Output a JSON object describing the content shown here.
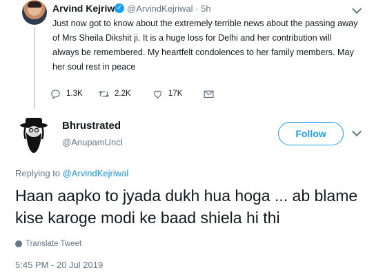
{
  "parent_tweet": {
    "author_name": "Arvind Kejriwal",
    "verified_icon": "✓",
    "handle_time": "@ArvindKejriwal · 5h",
    "text": "Just now got to know about the extremely terrible news about the passing away of Mrs Sheila Dikshit ji. It is a huge loss for Delhi and her contribution will always be remembered. My heartfelt condolences to her family members. May her soul rest in peace",
    "replies": "1.3K",
    "retweets": "2.2K",
    "likes": "17K"
  },
  "reply_tweet": {
    "author_name": "Bhrustrated",
    "handle": "@AnupamUncl",
    "follow_label": "Follow",
    "replying_prefix": "Replying to ",
    "replying_handle": "@ArvindKejriwal",
    "text": "Haan aapko to jyada dukh hua hoga  ... ab blame kise karoge modi ke baad shiela hi thi",
    "translate_label": "Translate Tweet",
    "timestamp": "5:45 PM - 20 Jul 2019"
  },
  "colors": {
    "accent": "#1da1f2",
    "secondary_text": "#657786",
    "primary_text": "#14171a"
  },
  "icons": [
    "verified-badge-icon",
    "chevron-down-icon",
    "reply-icon",
    "retweet-icon",
    "like-icon",
    "message-icon",
    "globe-icon"
  ]
}
